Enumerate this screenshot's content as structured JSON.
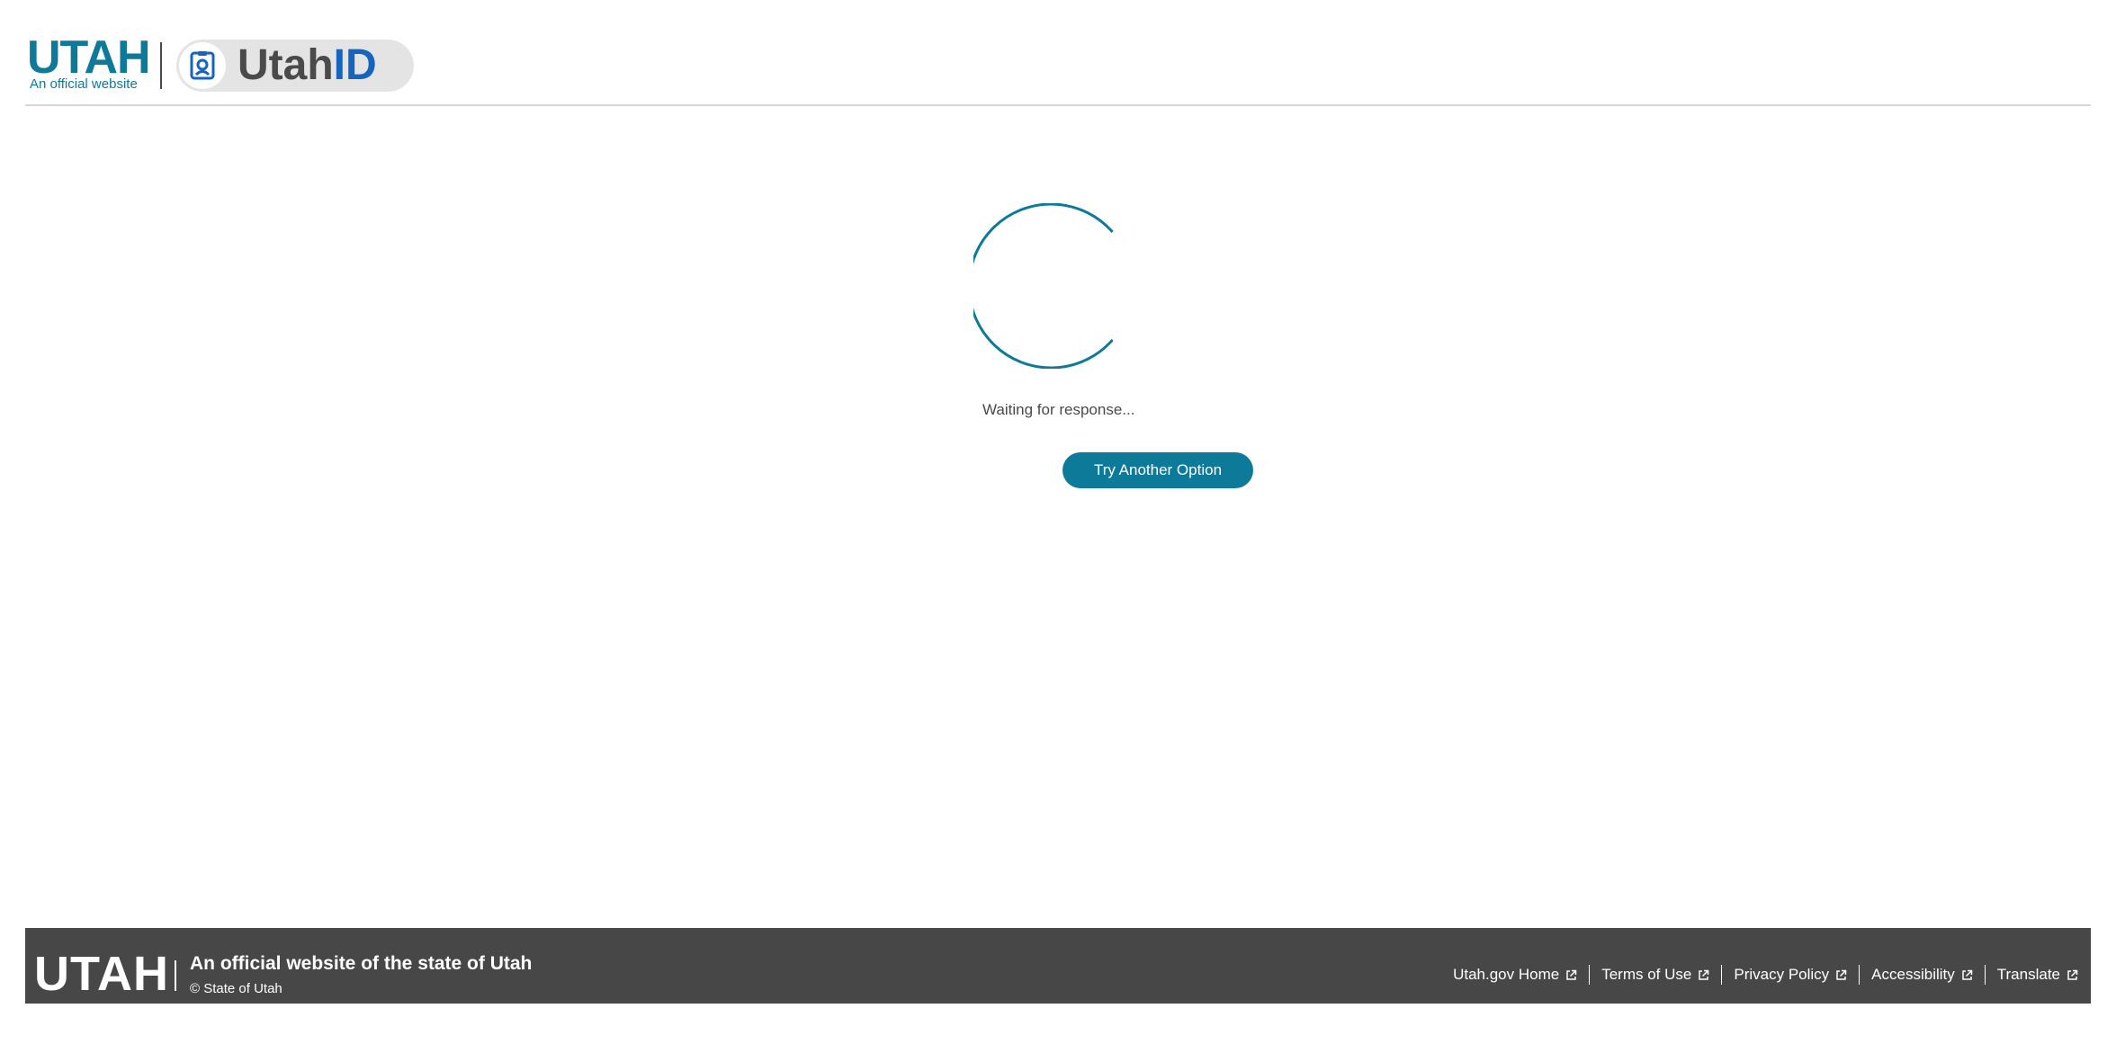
{
  "header": {
    "utah_logo": {
      "wordmark": "UTAH",
      "subtitle": "An official website"
    },
    "utahid_logo": {
      "text_part1": "Utah",
      "text_part2": "ID",
      "icon": "id-badge-icon"
    }
  },
  "main": {
    "spinner_icon": "loading-spinner-icon",
    "status_text": "Waiting for response...",
    "try_another_label": "Try Another Option"
  },
  "footer": {
    "wordmark": "UTAH",
    "official_text": "An official website of the state of Utah",
    "copyright": "© State of Utah",
    "links": [
      {
        "label": "Utah.gov Home",
        "icon": "external-link-icon"
      },
      {
        "label": "Terms of Use",
        "icon": "external-link-icon"
      },
      {
        "label": "Privacy Policy",
        "icon": "external-link-icon"
      },
      {
        "label": "Accessibility",
        "icon": "external-link-icon"
      },
      {
        "label": "Translate",
        "icon": "external-link-icon"
      }
    ]
  },
  "colors": {
    "brand_teal": "#0e7a9a",
    "utahid_blue": "#1565c0",
    "footer_bg": "#474747",
    "text_dark": "#4a4a4a"
  }
}
